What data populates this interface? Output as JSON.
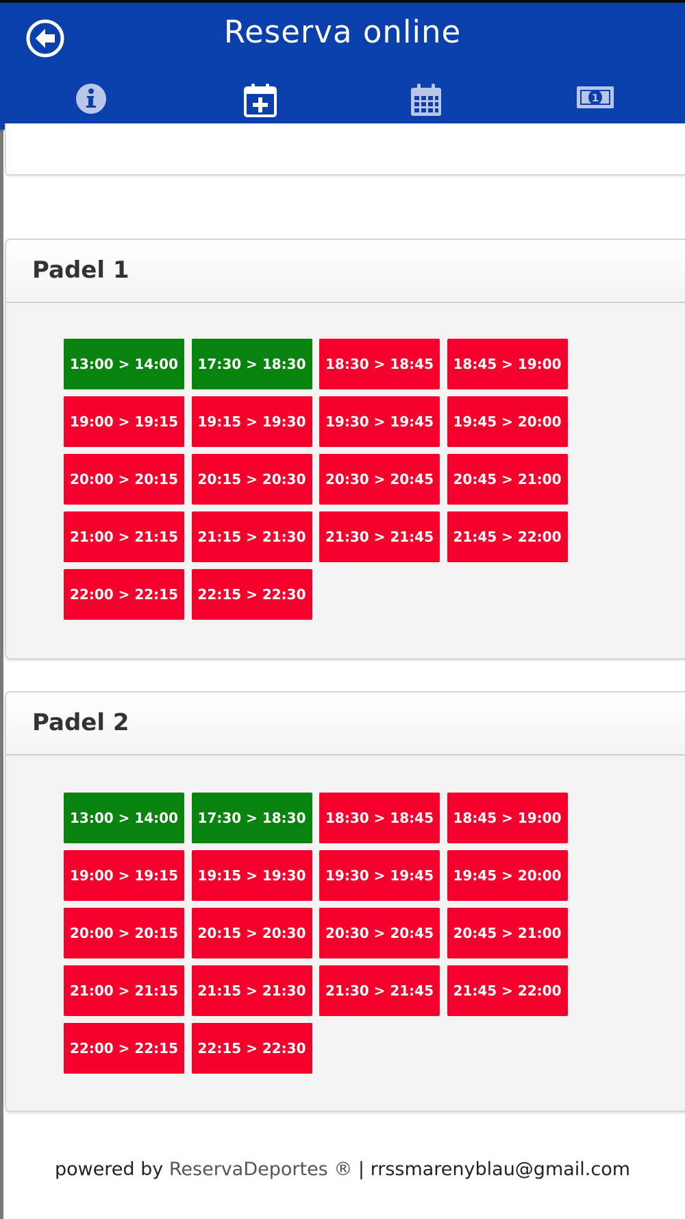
{
  "header": {
    "title": "Reserva online",
    "tabs": [
      {
        "icon": "info-icon",
        "active": false
      },
      {
        "icon": "calendar-plus-icon",
        "active": true
      },
      {
        "icon": "calendar-grid-icon",
        "active": false
      },
      {
        "icon": "money-bill-icon",
        "active": false
      }
    ]
  },
  "colors": {
    "header_bg": "#0a3fac",
    "slot_free": "#07830e",
    "slot_busy": "#f4022b"
  },
  "courts": [
    {
      "name": "Padel 1",
      "slots": [
        {
          "label": "13:00 > 14:00",
          "status": "free"
        },
        {
          "label": "17:30 > 18:30",
          "status": "free"
        },
        {
          "label": "18:30 > 18:45",
          "status": "busy"
        },
        {
          "label": "18:45 > 19:00",
          "status": "busy"
        },
        {
          "label": "19:00 > 19:15",
          "status": "busy"
        },
        {
          "label": "19:15 > 19:30",
          "status": "busy"
        },
        {
          "label": "19:30 > 19:45",
          "status": "busy"
        },
        {
          "label": "19:45 > 20:00",
          "status": "busy"
        },
        {
          "label": "20:00 > 20:15",
          "status": "busy"
        },
        {
          "label": "20:15 > 20:30",
          "status": "busy"
        },
        {
          "label": "20:30 > 20:45",
          "status": "busy"
        },
        {
          "label": "20:45 > 21:00",
          "status": "busy"
        },
        {
          "label": "21:00 > 21:15",
          "status": "busy"
        },
        {
          "label": "21:15 > 21:30",
          "status": "busy"
        },
        {
          "label": "21:30 > 21:45",
          "status": "busy"
        },
        {
          "label": "21:45 > 22:00",
          "status": "busy"
        },
        {
          "label": "22:00 > 22:15",
          "status": "busy"
        },
        {
          "label": "22:15 > 22:30",
          "status": "busy"
        }
      ]
    },
    {
      "name": "Padel 2",
      "slots": [
        {
          "label": "13:00 > 14:00",
          "status": "free"
        },
        {
          "label": "17:30 > 18:30",
          "status": "free"
        },
        {
          "label": "18:30 > 18:45",
          "status": "busy"
        },
        {
          "label": "18:45 > 19:00",
          "status": "busy"
        },
        {
          "label": "19:00 > 19:15",
          "status": "busy"
        },
        {
          "label": "19:15 > 19:30",
          "status": "busy"
        },
        {
          "label": "19:30 > 19:45",
          "status": "busy"
        },
        {
          "label": "19:45 > 20:00",
          "status": "busy"
        },
        {
          "label": "20:00 > 20:15",
          "status": "busy"
        },
        {
          "label": "20:15 > 20:30",
          "status": "busy"
        },
        {
          "label": "20:30 > 20:45",
          "status": "busy"
        },
        {
          "label": "20:45 > 21:00",
          "status": "busy"
        },
        {
          "label": "21:00 > 21:15",
          "status": "busy"
        },
        {
          "label": "21:15 > 21:30",
          "status": "busy"
        },
        {
          "label": "21:30 > 21:45",
          "status": "busy"
        },
        {
          "label": "21:45 > 22:00",
          "status": "busy"
        },
        {
          "label": "22:00 > 22:15",
          "status": "busy"
        },
        {
          "label": "22:15 > 22:30",
          "status": "busy"
        }
      ]
    }
  ],
  "footer": {
    "prefix": "powered by ",
    "brand": "ReservaDeportes ®",
    "separator": " | ",
    "email": "rrssmarenyblau@gmail.com"
  }
}
